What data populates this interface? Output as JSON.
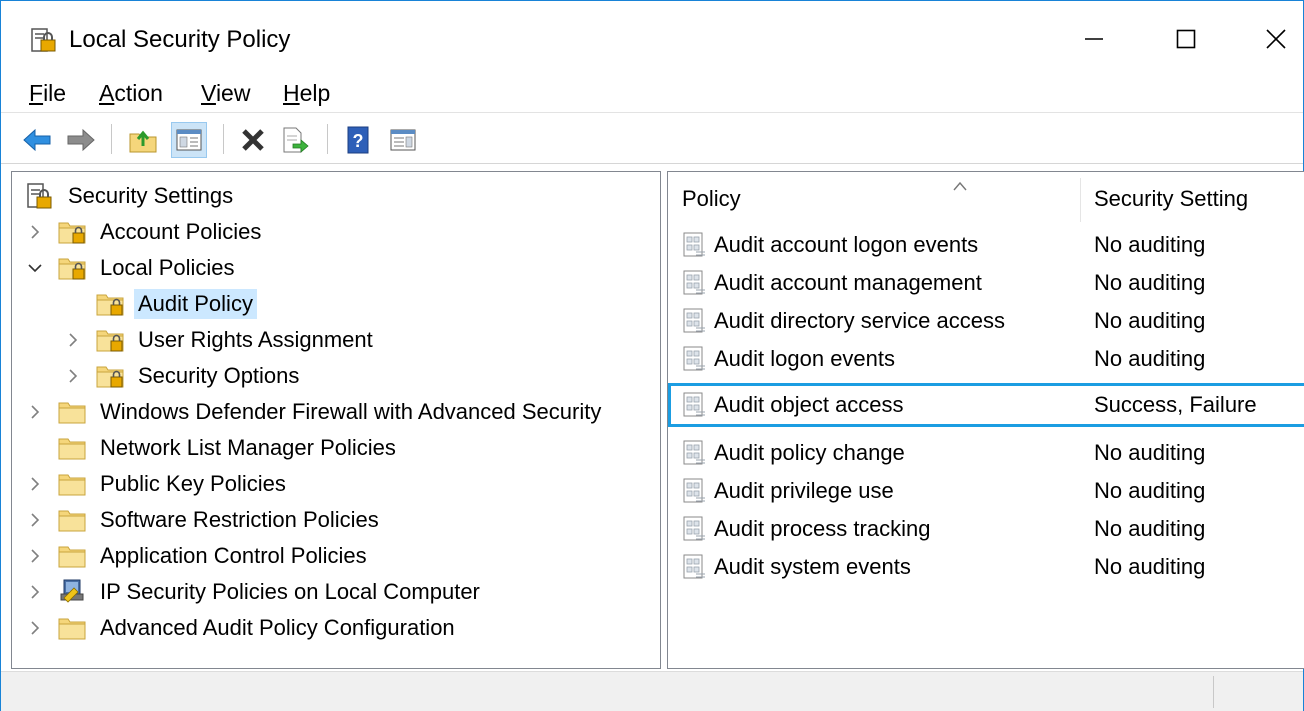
{
  "window": {
    "title": "Local Security Policy",
    "icon": "security-policy-icon",
    "controls": [
      "minimize-icon",
      "maximize-icon",
      "close-icon"
    ]
  },
  "menu": [
    {
      "label": "File",
      "accel": "F",
      "rest": "ile"
    },
    {
      "label": "Action",
      "accel": "A",
      "rest": "ction"
    },
    {
      "label": "View",
      "accel": "V",
      "rest": "iew"
    },
    {
      "label": "Help",
      "accel": "H",
      "rest": "elp"
    }
  ],
  "toolbar": {
    "buttons": [
      "back-icon",
      "forward-icon",
      "up-folder-icon",
      "show-hide-tree-icon",
      "delete-icon",
      "export-list-icon",
      "help-icon",
      "action-pane-icon"
    ],
    "pressed": "show-hide-tree-icon"
  },
  "tree": {
    "root": "Security Settings",
    "items": [
      {
        "label": "Account Policies",
        "expander": "collapsed",
        "icon": "locked-folder-icon",
        "depth": 1
      },
      {
        "label": "Local Policies",
        "expander": "expanded",
        "icon": "locked-folder-icon",
        "depth": 1
      },
      {
        "label": "Audit Policy",
        "expander": "none",
        "icon": "locked-folder-icon",
        "depth": 2,
        "selected": true
      },
      {
        "label": "User Rights Assignment",
        "expander": "collapsed",
        "icon": "locked-folder-icon",
        "depth": 2
      },
      {
        "label": "Security Options",
        "expander": "collapsed",
        "icon": "locked-folder-icon",
        "depth": 2
      },
      {
        "label": "Windows Defender Firewall with Advanced Security",
        "expander": "collapsed",
        "icon": "folder-icon",
        "depth": 1
      },
      {
        "label": "Network List Manager Policies",
        "expander": "none",
        "icon": "folder-icon",
        "depth": 1
      },
      {
        "label": "Public Key Policies",
        "expander": "collapsed",
        "icon": "folder-icon",
        "depth": 1
      },
      {
        "label": "Software Restriction Policies",
        "expander": "collapsed",
        "icon": "folder-icon",
        "depth": 1
      },
      {
        "label": "Application Control Policies",
        "expander": "collapsed",
        "icon": "folder-icon",
        "depth": 1
      },
      {
        "label": "IP Security Policies on Local Computer",
        "expander": "collapsed",
        "icon": "ip-security-icon",
        "depth": 1
      },
      {
        "label": "Advanced Audit Policy Configuration",
        "expander": "collapsed",
        "icon": "folder-icon",
        "depth": 1
      }
    ]
  },
  "list": {
    "columns": {
      "policy": "Policy",
      "setting": "Security Setting"
    },
    "sort_indicator": "sort-ascending-icon",
    "rows": [
      {
        "policy": "Audit account logon events",
        "setting": "No auditing"
      },
      {
        "policy": "Audit account management",
        "setting": "No auditing"
      },
      {
        "policy": "Audit directory service access",
        "setting": "No auditing"
      },
      {
        "policy": "Audit logon events",
        "setting": "No auditing"
      },
      {
        "policy": "Audit object access",
        "setting": "Success, Failure",
        "focused": true
      },
      {
        "policy": "Audit policy change",
        "setting": "No auditing"
      },
      {
        "policy": "Audit privilege use",
        "setting": "No auditing"
      },
      {
        "policy": "Audit process tracking",
        "setting": "No auditing"
      },
      {
        "policy": "Audit system events",
        "setting": "No auditing"
      }
    ]
  },
  "colors": {
    "window_border": "#1883d7",
    "selection": "#cce8ff",
    "focus_border": "#1b9de2",
    "folder": "#f5d67b"
  }
}
